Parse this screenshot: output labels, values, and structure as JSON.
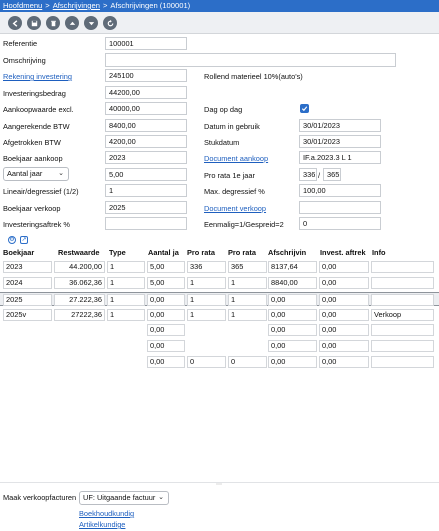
{
  "breadcrumb": {
    "items": [
      "Hoofdmenu",
      "Afschrijvingen",
      "Afschrijvingen (100001)"
    ],
    "separator": ">"
  },
  "toolbar": {
    "buttons": [
      "back-icon",
      "save-icon",
      "delete-icon",
      "up-icon",
      "down-icon",
      "refresh-icon"
    ]
  },
  "form": {
    "referentie": {
      "label": "Referentie",
      "value": "100001"
    },
    "omschrijving": {
      "label": "Omschrijving",
      "value": ""
    },
    "rekening": {
      "label": "Rekening investering",
      "value": "245100",
      "desc": "Rollend materieel 10%(auto's)"
    },
    "investeringsbedrag": {
      "label": "Investeringsbedrag",
      "value": "44200,00"
    },
    "aankoopwaarde": {
      "label": "Aankoopwaarde excl.",
      "value": "40000,00"
    },
    "dag_op_dag": {
      "label": "Dag op dag",
      "checked": true
    },
    "aangerekende_btw": {
      "label": "Aangerekende BTW",
      "value": "8400,00"
    },
    "datum_in_gebruik": {
      "label": "Datum in gebruik",
      "value": "30/01/2023"
    },
    "afgetrokken_btw": {
      "label": "Afgetrokken BTW",
      "value": "4200,00"
    },
    "stukdatum": {
      "label": "Stukdatum",
      "value": "30/01/2023"
    },
    "boekjaar_aankoop": {
      "label": "Boekjaar aankoop",
      "value": "2023"
    },
    "document_aankoop": {
      "label": "Document aankoop",
      "value": "IF.a.2023.3 L 1"
    },
    "aantal_jaar": {
      "select": "Aantal jaar",
      "value": "5,00"
    },
    "pro_rata": {
      "label": "Pro rata 1e jaar",
      "num": "336",
      "slash": "/",
      "den": "365"
    },
    "lineair": {
      "label": "Lineair/degressief (1/2)",
      "value": "1"
    },
    "max_degressief": {
      "label": "Max. degressief %",
      "value": "100,00"
    },
    "boekjaar_verkoop": {
      "label": "Boekjaar verkoop",
      "value": "2025"
    },
    "document_verkoop": {
      "label": "Document verkoop",
      "value": ""
    },
    "investeringsaftrek": {
      "label": "Investeringsaftrek %",
      "value": ""
    },
    "eenmalig": {
      "label": "Eenmalig=1/Gespreid=2",
      "value": "0"
    }
  },
  "grid": {
    "icons": [
      "settings-icon",
      "export-icon"
    ],
    "columns": [
      "Boekjaar",
      "Restwaarde",
      "Type",
      "Aantal ja",
      "Pro rata",
      "Pro rata",
      "Afschrijvin",
      "Invest. aftrek",
      "Info"
    ],
    "rows": [
      [
        "2023",
        "44.200,00",
        "1",
        "5,00",
        "336",
        "365",
        "8137,64",
        "0,00",
        ""
      ],
      [
        "2024",
        "36.062,36",
        "1",
        "5,00",
        "1",
        "1",
        "8840,00",
        "0,00",
        ""
      ],
      [
        "2025",
        "27.222,36",
        "1",
        "0,00",
        "1",
        "1",
        "0,00",
        "0,00",
        ""
      ],
      [
        "2025v",
        "27222,36",
        "1",
        "0,00",
        "1",
        "1",
        "0,00",
        "0,00",
        "Verkoop"
      ],
      [
        "",
        "",
        "",
        "0,00",
        "",
        "",
        "0,00",
        "0,00",
        ""
      ],
      [
        "",
        "",
        "",
        "0,00",
        "",
        "",
        "0,00",
        "0,00",
        ""
      ],
      [
        "",
        "",
        "",
        "0,00",
        "0",
        "0",
        "0,00",
        "0,00",
        ""
      ]
    ],
    "highlighted_row": 2
  },
  "footer": {
    "label": "Maak verkoopfacturen",
    "select": "UF: Uitgaande factuur",
    "links": [
      "Boekhoudkundig",
      "Artikelkundige"
    ]
  }
}
